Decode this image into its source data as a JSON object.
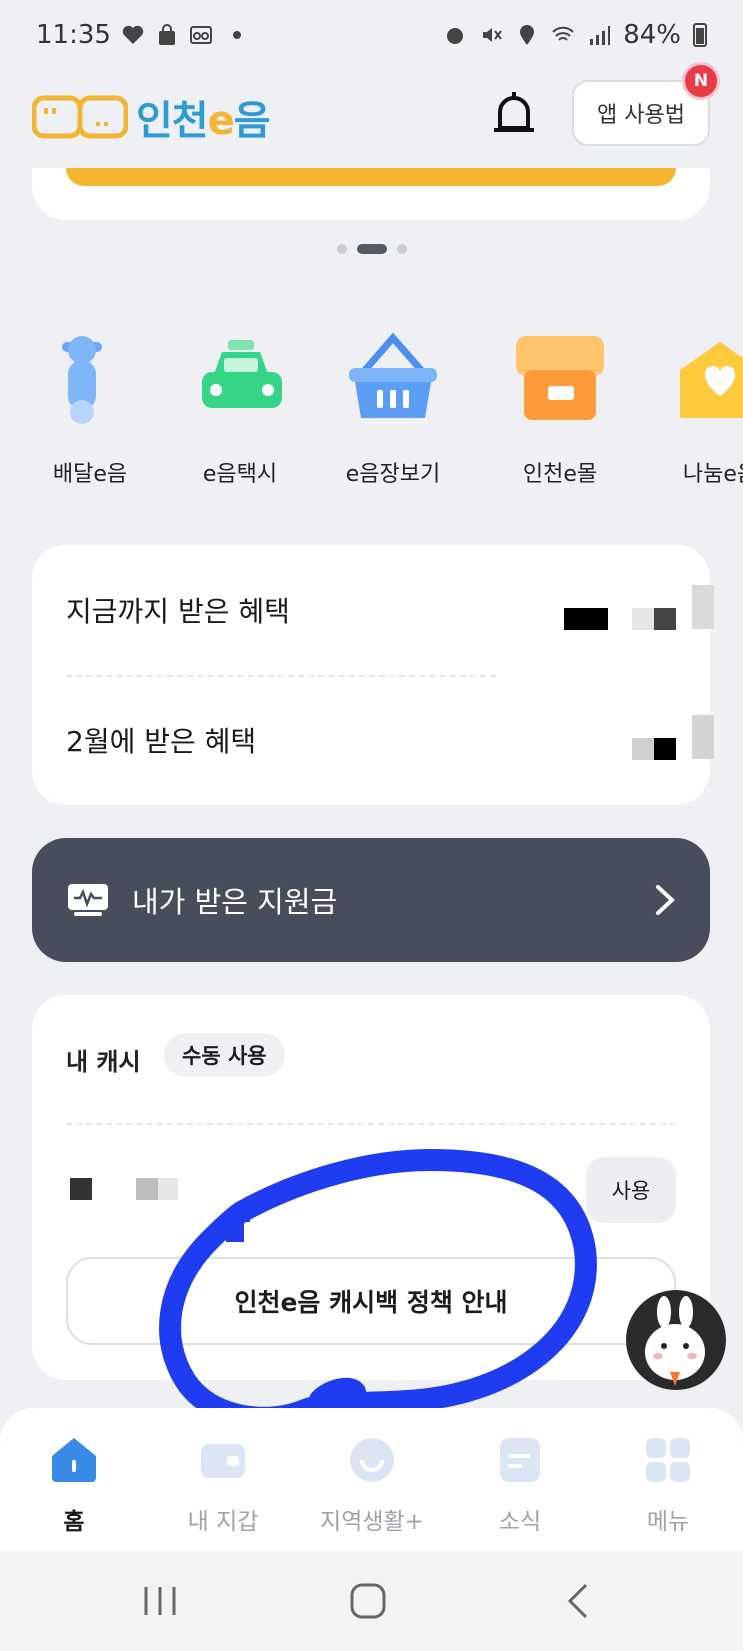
{
  "status_bar": {
    "time": "11:35",
    "battery": "84%"
  },
  "header": {
    "logo_text_prefix": "인천",
    "logo_text_e": "e",
    "logo_text_suffix": "음",
    "guide_button": "앱 사용법",
    "notification_badge": "N"
  },
  "quick_menu": [
    {
      "label": "배달e음",
      "icon": "scooter-icon"
    },
    {
      "label": "e음택시",
      "icon": "taxi-icon"
    },
    {
      "label": "e음장보기",
      "icon": "basket-icon"
    },
    {
      "label": "인천e몰",
      "icon": "store-icon"
    },
    {
      "label": "나눔e음",
      "icon": "heart-envelope-icon"
    }
  ],
  "benefits": {
    "total_label": "지금까지 받은 혜택",
    "monthly_label": "2월에 받은 혜택"
  },
  "support": {
    "label": "내가 받은 지원금"
  },
  "cash": {
    "title": "내 캐시",
    "mode_pill": "수동 사용",
    "use_button": "사용",
    "policy_button": "인천e음 캐시백 정책 안내"
  },
  "bottom_nav": [
    {
      "label": "홈",
      "active": true
    },
    {
      "label": "내 지갑",
      "active": false
    },
    {
      "label": "지역생활+",
      "active": false
    },
    {
      "label": "소식",
      "active": false
    },
    {
      "label": "메뉴",
      "active": false
    }
  ],
  "colors": {
    "accent_blue": "#2f9bd3",
    "accent_yellow": "#f5b731",
    "support_bar": "#474d5a",
    "scribble": "#1f3cf0"
  }
}
